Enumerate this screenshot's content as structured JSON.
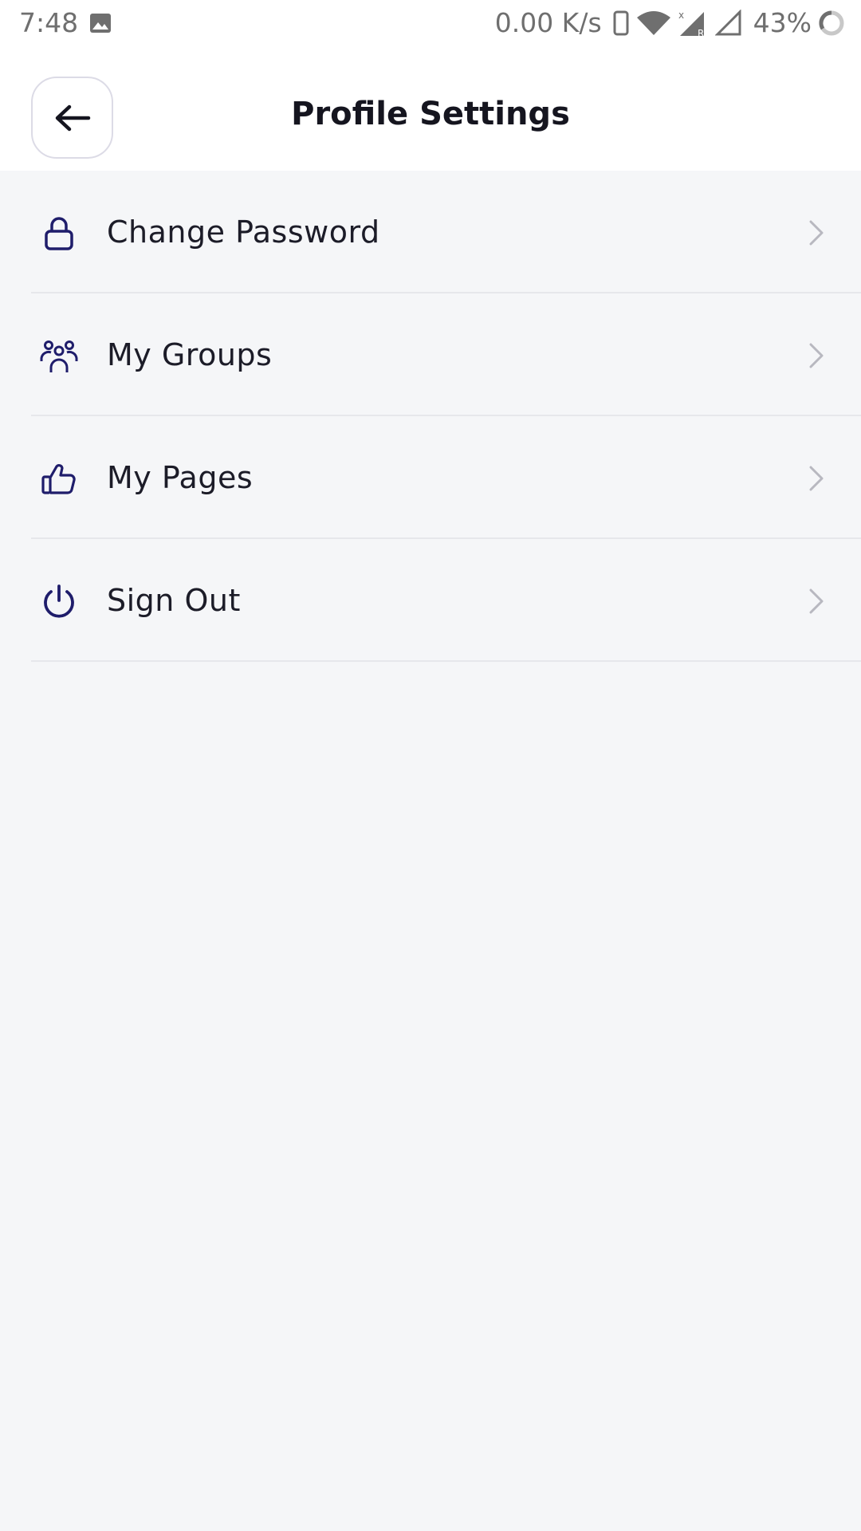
{
  "status_bar": {
    "time": "7:48",
    "net_speed": "0.00 K/s",
    "battery_percent": "43%",
    "icons": [
      "gallery-icon",
      "vibrate-icon",
      "wifi-icon",
      "signal-icon",
      "signal-empty-icon",
      "battery-ring-icon"
    ]
  },
  "header": {
    "back_icon": "arrow-left-icon",
    "title": "Profile Settings"
  },
  "menu": {
    "items": [
      {
        "label": "Change Password",
        "icon": "lock-icon"
      },
      {
        "label": "My Groups",
        "icon": "users-icon"
      },
      {
        "label": "My Pages",
        "icon": "thumbs-up-icon"
      },
      {
        "label": "Sign Out",
        "icon": "power-icon"
      }
    ]
  },
  "colors": {
    "icon_accent": "#1f1d6b",
    "background": "#f5f6f8",
    "header_background": "#ffffff",
    "chevron": "#b8b8c0",
    "divider": "#e6e7eb"
  }
}
